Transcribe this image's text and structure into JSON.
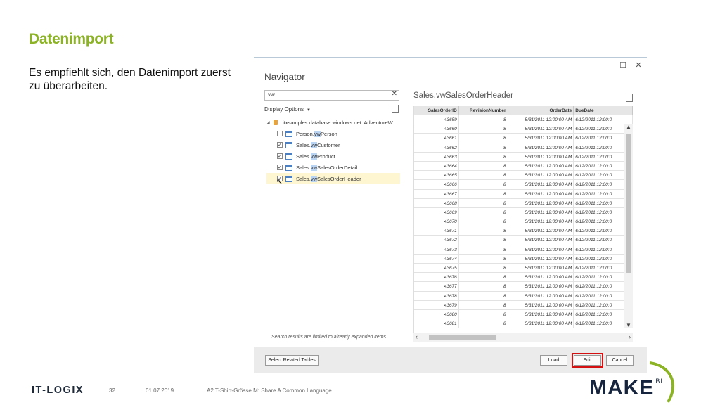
{
  "slide": {
    "title": "Datenimport",
    "body": "Es empfiehlt sich, den Datenimport zuerst zu überarbeiten.",
    "footer": {
      "logo_left": "IT-LOGIX",
      "page": "32",
      "date": "01.07.2019",
      "text": "A2 T-Shirt-Grösse M: Share A Common Language",
      "logo_right": "MAKE",
      "logo_right_sup": "BI"
    }
  },
  "navigator": {
    "title": "Navigator",
    "controls": {
      "restore": "☐",
      "close": "✕"
    },
    "search": {
      "value": "vw",
      "clear": "✕"
    },
    "display_options": "Display Options",
    "search_note": "Search results are limited to already expanded items",
    "tree": {
      "database": "itxsamples.database.windows.net: AdventureW...",
      "items": [
        {
          "prefix": "Person.",
          "match": "vw",
          "suffix": "Person",
          "checked": false
        },
        {
          "prefix": "Sales.",
          "match": "vw",
          "suffix": "Customer",
          "checked": true
        },
        {
          "prefix": "Sales.",
          "match": "vw",
          "suffix": "Product",
          "checked": true
        },
        {
          "prefix": "Sales.",
          "match": "vw",
          "suffix": "SalesOrderDetail",
          "checked": true
        },
        {
          "prefix": "Sales.",
          "match": "vw",
          "suffix": "SalesOrderHeader",
          "checked": true,
          "selected": true
        }
      ]
    },
    "preview": {
      "title": "Sales.vwSalesOrderHeader",
      "columns": [
        "SalesOrderID",
        "RevisionNumber",
        "OrderDate",
        "DueDate"
      ],
      "rows": [
        [
          "43659",
          "8",
          "5/31/2011 12:00:00 AM",
          "6/12/2011 12:00:0"
        ],
        [
          "43660",
          "8",
          "5/31/2011 12:00:00 AM",
          "6/12/2011 12:00:0"
        ],
        [
          "43661",
          "8",
          "5/31/2011 12:00:00 AM",
          "6/12/2011 12:00:0"
        ],
        [
          "43662",
          "8",
          "5/31/2011 12:00:00 AM",
          "6/12/2011 12:00:0"
        ],
        [
          "43663",
          "8",
          "5/31/2011 12:00:00 AM",
          "6/12/2011 12:00:0"
        ],
        [
          "43664",
          "8",
          "5/31/2011 12:00:00 AM",
          "6/12/2011 12:00:0"
        ],
        [
          "43665",
          "8",
          "5/31/2011 12:00:00 AM",
          "6/12/2011 12:00:0"
        ],
        [
          "43666",
          "8",
          "5/31/2011 12:00:00 AM",
          "6/12/2011 12:00:0"
        ],
        [
          "43667",
          "8",
          "5/31/2011 12:00:00 AM",
          "6/12/2011 12:00:0"
        ],
        [
          "43668",
          "8",
          "5/31/2011 12:00:00 AM",
          "6/12/2011 12:00:0"
        ],
        [
          "43669",
          "8",
          "5/31/2011 12:00:00 AM",
          "6/12/2011 12:00:0"
        ],
        [
          "43670",
          "8",
          "5/31/2011 12:00:00 AM",
          "6/12/2011 12:00:0"
        ],
        [
          "43671",
          "8",
          "5/31/2011 12:00:00 AM",
          "6/12/2011 12:00:0"
        ],
        [
          "43672",
          "8",
          "5/31/2011 12:00:00 AM",
          "6/12/2011 12:00:0"
        ],
        [
          "43673",
          "8",
          "5/31/2011 12:00:00 AM",
          "6/12/2011 12:00:0"
        ],
        [
          "43674",
          "8",
          "5/31/2011 12:00:00 AM",
          "6/12/2011 12:00:0"
        ],
        [
          "43675",
          "8",
          "5/31/2011 12:00:00 AM",
          "6/12/2011 12:00:0"
        ],
        [
          "43676",
          "8",
          "5/31/2011 12:00:00 AM",
          "6/12/2011 12:00:0"
        ],
        [
          "43677",
          "8",
          "5/31/2011 12:00:00 AM",
          "6/12/2011 12:00:0"
        ],
        [
          "43678",
          "8",
          "5/31/2011 12:00:00 AM",
          "6/12/2011 12:00:0"
        ],
        [
          "43679",
          "8",
          "5/31/2011 12:00:00 AM",
          "6/12/2011 12:00:0"
        ],
        [
          "43680",
          "8",
          "5/31/2011 12:00:00 AM",
          "6/12/2011 12:00:0"
        ],
        [
          "43681",
          "8",
          "5/31/2011 12:00:00 AM",
          "6/12/2011 12:00:0"
        ]
      ]
    },
    "buttons": {
      "select_related": "Select Related Tables",
      "load": "Load",
      "edit": "Edit",
      "cancel": "Cancel"
    },
    "colors": {
      "title_green": "#8cb325",
      "highlight_red": "#d41010",
      "selected_row": "#fdf6d0",
      "match_highlight": "#b9d4f3"
    }
  }
}
